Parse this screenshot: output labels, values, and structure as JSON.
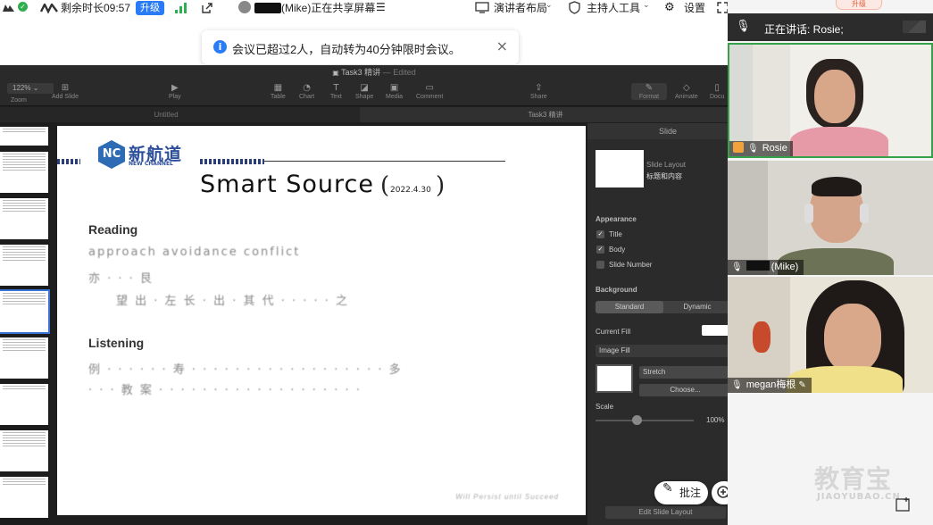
{
  "topbar": {
    "time_left": "剩余时长09:57",
    "upgrade": "升级",
    "sharing": "(Mike)正在共享屏幕",
    "presenter_layout": "演讲者布局",
    "host_tools": "主持人工具",
    "settings": "设置"
  },
  "toast": {
    "message": "会议已超过2人，自动转为40分钟限时会议。"
  },
  "keynote": {
    "window_title": "Task3 精讲",
    "edited": "— Edited",
    "zoom": "122%",
    "tools": {
      "zoom": "Zoom",
      "add_slide": "Add Slide",
      "play": "Play",
      "table": "Table",
      "chart": "Chart",
      "text": "Text",
      "shape": "Shape",
      "media": "Media",
      "comment": "Comment",
      "share": "Share",
      "format": "Format",
      "animate": "Animate",
      "document": "Docu"
    },
    "tabs": [
      "Untitled",
      "Task3 精讲"
    ],
    "slide": {
      "logo_mark": "NC",
      "logo_cn": "新航道",
      "logo_en": "NEW CHANNEL",
      "title": "Smart Source",
      "date": "2022.4.30",
      "reading": "Reading",
      "reading_line1": "approach   avoidance   conflict",
      "reading_line2": "亦  ·  ·  ·  艮",
      "reading_line3": "望  出  ·  左  长  ·  出  ·  其  代  ·  ·  ·  ·  ·  之",
      "listening": "Listening",
      "listening_line1": "例  ·  ·  ·  ·  ·  ·  寿  ·  ·  ·  ·  ·  ·  ·  ·  ·  ·  ·  ·  ·  ·  ·  ·  ·  ·  多",
      "listening_line2": "·  ·  ·  教  案  ·  ·  ·  ·  ·  ·  ·  ·  ·  ·  ·  ·  ·  ·  ·  ·  ·  ·  ·",
      "motto": "Will   Persist   until   Succeed"
    },
    "inspector": {
      "tab": "Slide",
      "layout_label": "Slide Layout",
      "layout_name": "标题和内容",
      "appearance": "Appearance",
      "title_cb": "Title",
      "body_cb": "Body",
      "slide_number_cb": "Slide Number",
      "background": "Background",
      "standard": "Standard",
      "dynamic": "Dynamic",
      "current_fill": "Current Fill",
      "image_fill": "Image Fill",
      "stretch": "Stretch",
      "choose": "Choose...",
      "scale": "Scale",
      "scale_value": "100%",
      "edit_layout": "Edit Slide Layout"
    }
  },
  "annotate": {
    "label": "批注"
  },
  "panel": {
    "top_peek": "升级",
    "speaking": "正在讲话:   Rosie;",
    "participants": [
      {
        "name": "Rosie"
      },
      {
        "name": "(Mike)"
      },
      {
        "name": "megan梅根"
      }
    ],
    "watermark": "教育宝",
    "watermark_en": "JIAOYUBAO.CN"
  }
}
